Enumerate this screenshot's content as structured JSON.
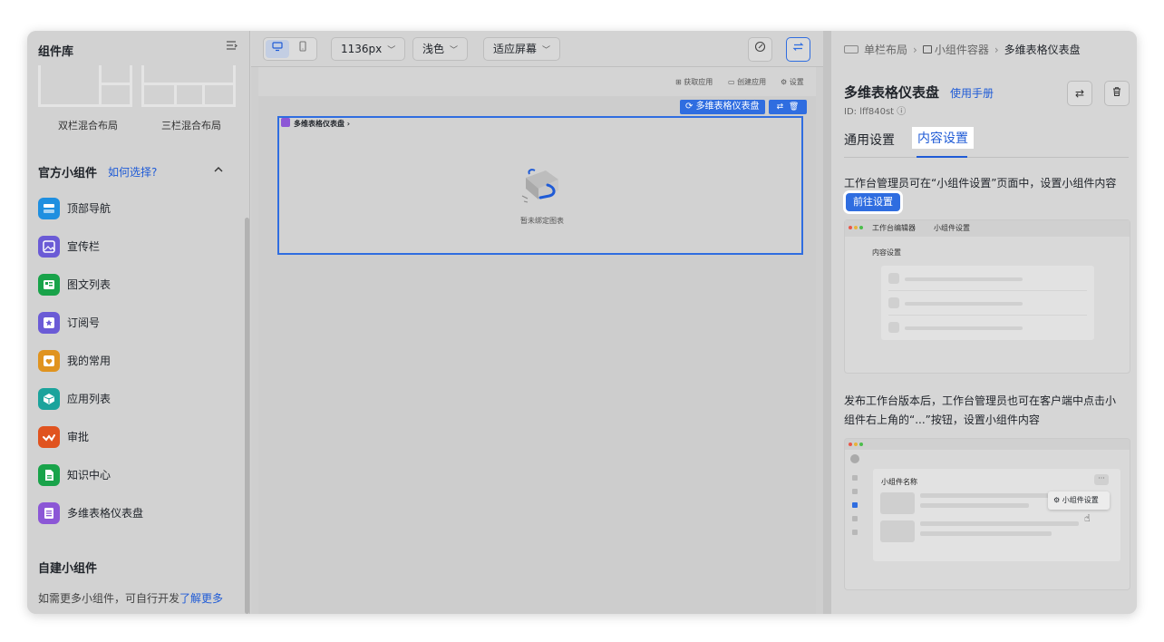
{
  "left_panel": {
    "title": "组件库",
    "layouts": [
      {
        "label": "双栏混合布局"
      },
      {
        "label": "三栏混合布局"
      }
    ],
    "official": {
      "title": "官方小组件",
      "help_link": "如何选择?",
      "items": [
        {
          "label": "顶部导航",
          "icon": "nav-icon",
          "color": "#1f8fe0"
        },
        {
          "label": "宣传栏",
          "icon": "image-icon",
          "color": "#6b5bd6"
        },
        {
          "label": "图文列表",
          "icon": "list-icon",
          "color": "#19a34a"
        },
        {
          "label": "订阅号",
          "icon": "star-icon",
          "color": "#6b5bd6"
        },
        {
          "label": "我的常用",
          "icon": "heart-icon",
          "color": "#e0931f"
        },
        {
          "label": "应用列表",
          "icon": "cube-icon",
          "color": "#1ba39c"
        },
        {
          "label": "审批",
          "icon": "check-icon",
          "color": "#e0531f"
        },
        {
          "label": "知识中心",
          "icon": "doc-icon",
          "color": "#19a34a"
        },
        {
          "label": "多维表格仪表盘",
          "icon": "table-icon",
          "color": "#8c57d6"
        }
      ]
    },
    "custom": {
      "title": "自建小组件",
      "desc": "如需更多小组件，可自行开发",
      "link": "了解更多"
    }
  },
  "toolbar": {
    "width_select": "1136px",
    "theme_select": "浅色",
    "fit_select": "适应屏幕"
  },
  "canvas": {
    "actions": {
      "get_app": "获取应用",
      "create_app": "创建应用",
      "settings": "设置"
    },
    "widget_tag": "多维表格仪表盘",
    "widget_header": "多维表格仪表盘",
    "empty_text": "暂未绑定图表"
  },
  "right_panel": {
    "breadcrumb": [
      "单栏布局",
      "小组件容器",
      "多维表格仪表盘"
    ],
    "title": "多维表格仪表盘",
    "manual_link": "使用手册",
    "id_text": "ID:  lff840st",
    "tabs": [
      "通用设置",
      "内容设置"
    ],
    "active_tab": 1,
    "text1": "工作台管理员可在“小组件设置”页面中，设置小组件内容",
    "goto_button": "前往设置",
    "preview1": {
      "tabs": [
        "工作台编辑器",
        "小组件设置"
      ],
      "heading": "内容设置"
    },
    "text2": "发布工作台版本后，工作台管理员也可在客户端中点击小组件右上角的“...”按钮，设置小组件内容",
    "preview2": {
      "card_title": "小组件名称",
      "menu_item": "小组件设置",
      "more": "···"
    }
  },
  "colors": {
    "accent": "#2f6de0",
    "link": "#1f5bd6"
  }
}
